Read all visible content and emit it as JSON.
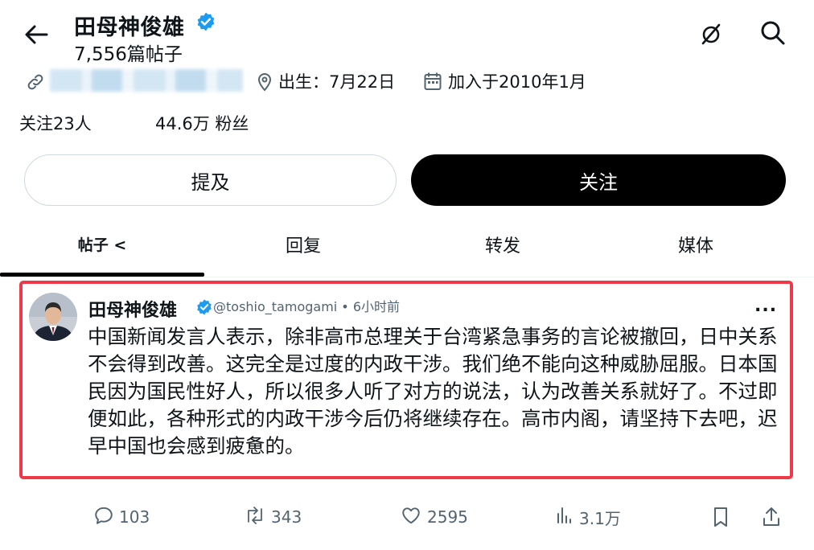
{
  "profile": {
    "name": "田母神俊雄",
    "post_count": "7,556篇帖子",
    "birth": "出生：7月22日",
    "joined": "加入于2010年1月",
    "following": "关注23人",
    "followers": "44.6万 粉丝"
  },
  "buttons": {
    "mention": "提及",
    "follow": "关注"
  },
  "tabs": [
    "帖子 <",
    "回复",
    "转发",
    "媒体"
  ],
  "post": {
    "author": "田母神俊雄",
    "handle_time": "@toshio_tamogami • 6小时前",
    "more": "...",
    "text": "中国新闻发言人表示，除非高市总理关于台湾紧急事务的言论被撤回，日中关系不会得到改善。这完全是过度的内政干涉。我们绝不能向这种威胁屈服。日本国民因为国民性好人，所以很多人听了对方的说法，认为改善关系就好了。不过即便如此，各种形式的内政干涉今后仍将继续存在。高市内阁，请坚持下去吧，迟早中国也会感到疲惫的。",
    "replies": "103",
    "reposts": "343",
    "likes": "2595",
    "views": "3.1万"
  },
  "colors": {
    "verified": "#1d9bf0",
    "highlight_border": "#ee3a48",
    "muted_text": "#536471",
    "follow_button_bg": "#000000"
  },
  "icons": [
    "back-arrow-icon",
    "mute-icon",
    "search-icon",
    "link-icon",
    "location-icon",
    "calendar-icon",
    "verified-icon",
    "reply-icon",
    "repost-icon",
    "like-icon",
    "views-icon",
    "bookmark-icon",
    "share-icon"
  ]
}
